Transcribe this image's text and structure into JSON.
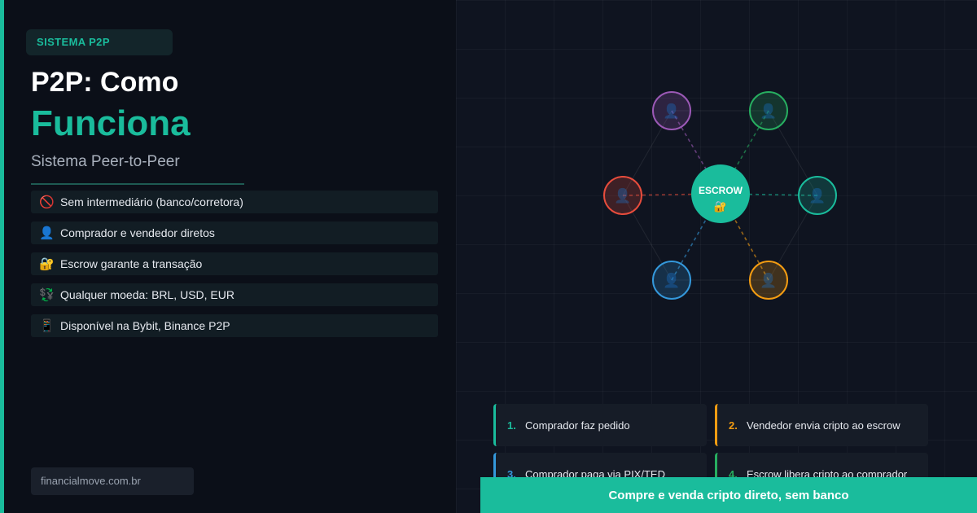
{
  "badge": "SISTEMA P2P",
  "title_line1": "P2P: Como",
  "title_line2": "Funciona",
  "subtitle": "Sistema Peer-to-Peer",
  "features": [
    {
      "icon": "🚫",
      "icon_name": "no-entry-icon",
      "text": "Sem intermediário (banco/corretora)"
    },
    {
      "icon": "👤",
      "icon_name": "person-icon",
      "text": "Comprador e vendedor diretos"
    },
    {
      "icon": "🔐",
      "icon_name": "lock-key-icon",
      "text": "Escrow garante a transação"
    },
    {
      "icon": "💱",
      "icon_name": "currency-exchange-icon",
      "text": "Qualquer moeda: BRL, USD, EUR"
    },
    {
      "icon": "📱",
      "icon_name": "mobile-phone-icon",
      "text": "Disponível na Bybit, Binance P2P"
    }
  ],
  "site": "financialmove.com.br",
  "diagram": {
    "center_label": "ESCROW",
    "center_icon": "🔐",
    "center_color": "#1abc9c",
    "node_icon": "👤",
    "node_colors": [
      "#9b59b6",
      "#27ae60",
      "#1abc9c",
      "#f39c12",
      "#3498db",
      "#e74c3c"
    ]
  },
  "steps": [
    {
      "num": "1.",
      "text": "Comprador faz pedido",
      "color": "#1abc9c"
    },
    {
      "num": "2.",
      "text": "Vendedor envia cripto ao escrow",
      "color": "#f39c12"
    },
    {
      "num": "3.",
      "text": "Comprador paga via PIX/TED",
      "color": "#3498db"
    },
    {
      "num": "4.",
      "text": "Escrow libera cripto ao comprador",
      "color": "#27ae60"
    }
  ],
  "cta": "Compre e venda cripto direto, sem banco"
}
